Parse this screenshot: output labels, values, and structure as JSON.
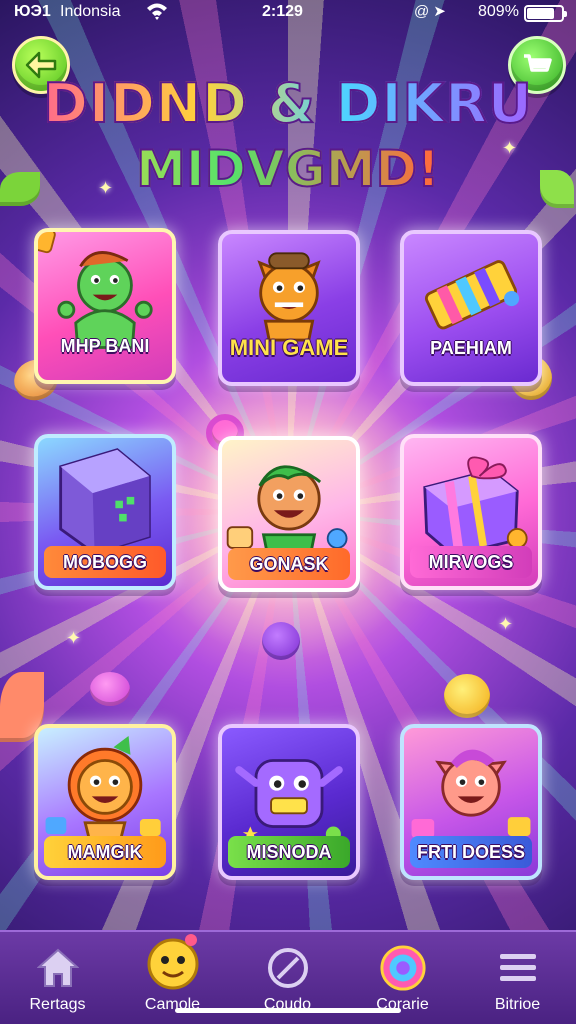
{
  "status_bar": {
    "signal": "ЮЭ1",
    "carrier": "Indonsia",
    "time": "2:129",
    "battery_text": "809%",
    "battery_level": 0.8
  },
  "header": {
    "title_line1": "DIDND & DIKRU",
    "title_line2": "MIDVGMD!"
  },
  "tiles": [
    {
      "label": "MHP BANI",
      "art": "green-monster-icon"
    },
    {
      "label": "MINI GAME",
      "art": "fox-character-icon"
    },
    {
      "label": "PAEHIAM",
      "art": "candy-bar-icon"
    },
    {
      "label": "MOBOGG",
      "art": "mystery-cube-icon"
    },
    {
      "label": "GONASK",
      "art": "boy-character-icon"
    },
    {
      "label": "MIRVOGS",
      "art": "gift-box-icon"
    },
    {
      "label": "MAMGIK",
      "art": "lion-character-icon"
    },
    {
      "label": "MISNODA",
      "art": "robot-character-icon"
    },
    {
      "label": "FRTI DOESS",
      "art": "pig-character-icon"
    }
  ],
  "bottom_nav": [
    {
      "label": "Rertags",
      "icon": "home-icon"
    },
    {
      "label": "Camole",
      "icon": "mascot-icon"
    },
    {
      "label": "Coudo",
      "icon": "no-entry-icon"
    },
    {
      "label": "Corarie",
      "icon": "swirl-orb-icon"
    },
    {
      "label": "Bitrioe",
      "icon": "menu-icon"
    }
  ],
  "colors": {
    "accent_green": "#4fbf1c",
    "nav_bg": "#5a2c96"
  }
}
